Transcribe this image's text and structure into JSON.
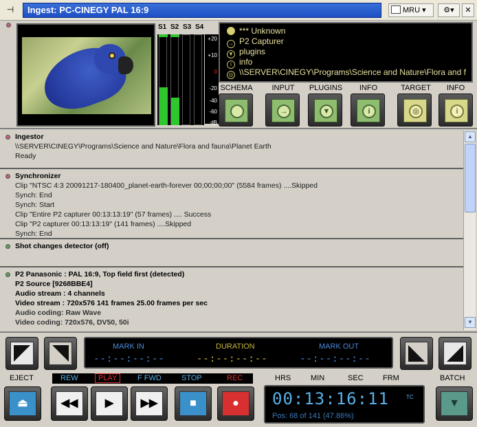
{
  "titlebar": {
    "title": "Ingest: PC-CINEGY PAL 16:9",
    "mru_label": "MRU",
    "pin_icon": "pin-icon"
  },
  "video": {
    "description_icon": "video-thumbnail"
  },
  "meters": {
    "channels": [
      "S1",
      "S2",
      "S3",
      "S4"
    ],
    "levels": [
      0.42,
      0.3,
      0,
      0
    ],
    "scale": [
      "+20",
      "+10",
      "0",
      "-20",
      "-40",
      "-60",
      "dB"
    ]
  },
  "info": {
    "items": [
      "*** Unknown",
      "P2 Capturer",
      "plugins",
      "info",
      "\\\\SERVER\\CINEGY\\Programs\\Science and Nature\\Flora and f"
    ]
  },
  "actions": {
    "schema": "SCHEMA",
    "input": "INPUT",
    "plugins": "PLUGINS",
    "info": "INFO",
    "target": "TARGET",
    "info2": "INFO"
  },
  "log": {
    "ingestor": {
      "title": "Ingestor",
      "lines": [
        "\\\\SERVER\\CINEGY\\Programs\\Science and Nature\\Flora and fauna\\Planet Earth",
        "Ready"
      ]
    },
    "synchronizer": {
      "title": "Synchronizer",
      "lines": [
        "Clip \"NTSC 4:3 20091217-180400_planet-earth-forever 00;00;00;00\" (5584 frames) ....Skipped",
        "Synch: End",
        "Synch: Start",
        "Clip \"Entire P2 capturer 00:13:13:19\" (57 frames) .... Success",
        "Clip \"P2 capturer 00:13:13:19\" (141 frames) ....Skipped",
        "Synch: End"
      ]
    },
    "shot": {
      "title": "Shot changes detector (off)"
    },
    "p2": {
      "title": "P2 Panasonic : PAL 16:9, Top field first (detected)",
      "lines": [
        "P2 Source [9268BBE4]",
        "Audio stream : 4 channels",
        "Video stream : 720x576  141 frames  25.00 frames per sec",
        "Audio coding: Raw Wave",
        "Video coding: 720x576, DV50, 50i"
      ]
    }
  },
  "mark": {
    "mark_in_label": "MARK IN",
    "mark_in_value": "--:--:--:--",
    "duration_label": "DURATION",
    "duration_value": "--:--:--:--",
    "mark_out_label": "MARK OUT",
    "mark_out_value": "--:--:--:--"
  },
  "transport": {
    "eject": "EJECT",
    "rew": "REW",
    "play": "PLAY",
    "ffwd": "F FWD",
    "stop": "STOP",
    "rec": "REC",
    "hrs": "HRS",
    "min": "MIN",
    "sec": "SEC",
    "frm": "FRM",
    "batch": "BATCH",
    "timecode": "00:13:16:11",
    "tc_tag": "TC",
    "position": "Pos: 68 of 141 (47.86%)"
  },
  "colors": {
    "accent_blue": "#5ab0e8",
    "mark_blue": "#4a8ad8",
    "duration_yellow": "#c8b840",
    "rec_red": "#d83030",
    "play_red": "#e03030"
  }
}
